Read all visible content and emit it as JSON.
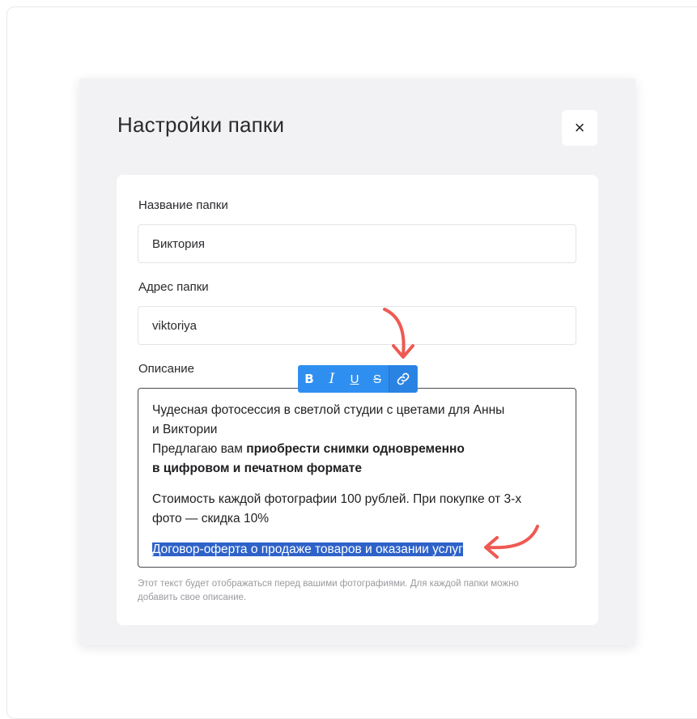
{
  "dialog": {
    "title": "Настройки папки",
    "close_label": "×"
  },
  "form": {
    "name_label": "Название папки",
    "name_value": "Виктория",
    "address_label": "Адрес папки",
    "address_value": "viktoriya",
    "description_label": "Описание",
    "toolbar": {
      "bold": "B",
      "italic": "I",
      "underline": "U",
      "strikethrough": "S",
      "link_icon": "link-icon"
    },
    "description": {
      "line1a": "Чудесная фотосессия в светлой студии с цветами для Анны",
      "line1b": "и Виктории",
      "line2_prefix": "Предлагаю вам ",
      "line2_bold": "приобрести снимки одновременно",
      "line3_bold": "в цифровом и печатном формате",
      "line4a": "Стоимость каждой фотографии 100 рублей. При покупке от 3-х",
      "line4b": "фото — скидка 10%",
      "selected_link_text": "Договор-оферта о продаже товаров и оказании услуг"
    },
    "hint_line1": "Этот текст будет отображаться перед вашими фотографиями. Для каждой папки можно",
    "hint_line2": "добавить свое описание."
  },
  "colors": {
    "toolbar": "#2f8ff0",
    "selection": "#2e62c9",
    "annotation_arrow": "#ee5a52"
  }
}
